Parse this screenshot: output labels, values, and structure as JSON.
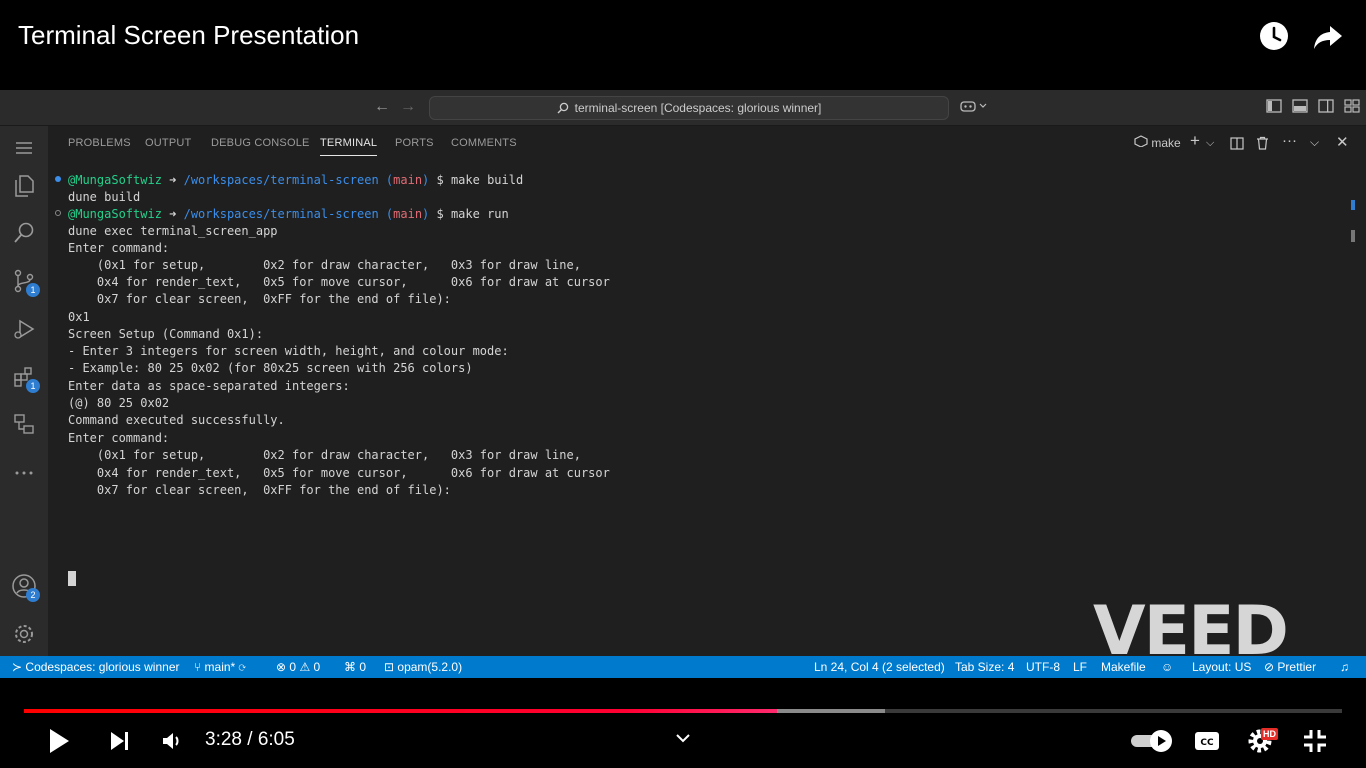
{
  "video": {
    "title": "Terminal Screen Presentation",
    "time_current": "3:28",
    "time_separator": " / ",
    "time_total": "6:05",
    "progress_fraction": 0.571,
    "buffered_fraction": 0.653,
    "hd_badge": "HD",
    "watermark": "VEED"
  },
  "titlebar": {
    "search_text": "terminal-screen [Codespaces: glorious winner]"
  },
  "activity_badges": {
    "source_control": "1",
    "extensions": "1",
    "accounts": "2"
  },
  "panel": {
    "tabs": [
      "PROBLEMS",
      "OUTPUT",
      "DEBUG CONSOLE",
      "TERMINAL",
      "PORTS",
      "COMMENTS"
    ],
    "active_tab": "TERMINAL",
    "terminal_name": "make"
  },
  "terminal": {
    "prompt1": {
      "user": "@MungaSoftwiz",
      "arrow": " ➜",
      "path": "/workspaces/terminal-screen",
      "branch_open": " (",
      "branch": "main",
      "branch_close": ")",
      "command": " $ make build"
    },
    "line2": "dune build",
    "prompt2": {
      "user": "@MungaSoftwiz",
      "arrow": " ➜",
      "path": "/workspaces/terminal-screen",
      "branch_open": " (",
      "branch": "main",
      "branch_close": ")",
      "command": " $ make run"
    },
    "lines": [
      "dune exec terminal_screen_app",
      "Enter command:",
      "    (0x1 for setup,        0x2 for draw character,   0x3 for draw line,",
      "    0x4 for render_text,   0x5 for move cursor,      0x6 for draw at cursor",
      "    0x7 for clear screen,  0xFF for the end of file):",
      "0x1",
      "Screen Setup (Command 0x1):",
      "- Enter 3 integers for screen width, height, and colour mode:",
      "- Example: 80 25 0x02 (for 80x25 screen with 256 colors)",
      "Enter data as space-separated integers:",
      "(@) 80 25 0x02",
      "Command executed successfully.",
      "Enter command:",
      "    (0x1 for setup,        0x2 for draw character,   0x3 for draw line,",
      "    0x4 for render_text,   0x5 for move cursor,      0x6 for draw at cursor",
      "    0x7 for clear screen,  0xFF for the end of file):"
    ]
  },
  "statusbar": {
    "remote": "Codespaces: glorious winner",
    "branch": "main*",
    "errors": "0",
    "warnings": "0",
    "ports": "0",
    "opam": "opam(5.2.0)",
    "position": "Ln 24, Col 4 (2 selected)",
    "tab_size": "Tab Size: 4",
    "encoding": "UTF-8",
    "eol": "LF",
    "language": "Makefile",
    "layout": "Layout: US",
    "prettier": "Prettier"
  },
  "colors": {
    "statusbar": "#007acc",
    "progress_played": "#ff0000",
    "prompt_user": "#23d18b",
    "prompt_path": "#3b8eea",
    "prompt_branch": "#e06c75"
  }
}
